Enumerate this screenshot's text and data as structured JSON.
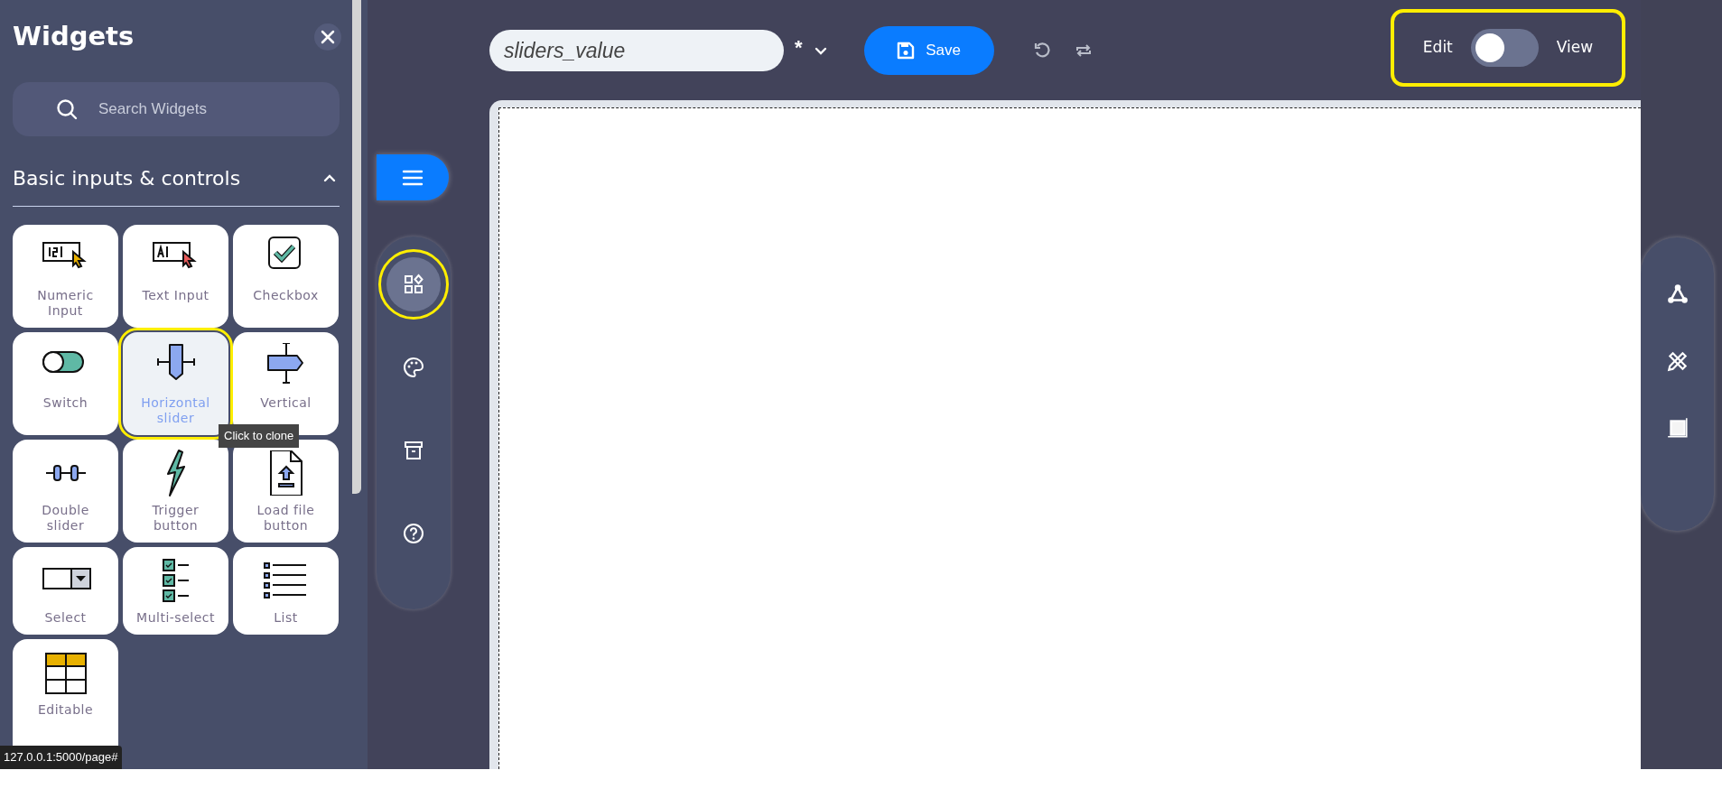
{
  "sidebar": {
    "title": "Widgets",
    "search": {
      "placeholder": "Search Widgets"
    },
    "section": {
      "title": "Basic inputs & controls",
      "expanded": true
    },
    "widgets": [
      {
        "label": "Numeric Input",
        "kind": "numeric",
        "selected": false,
        "highlighted": false
      },
      {
        "label": "Text Input",
        "kind": "text",
        "selected": false,
        "highlighted": false
      },
      {
        "label": "Checkbox",
        "kind": "checkbox",
        "selected": false,
        "highlighted": false
      },
      {
        "label": "Switch",
        "kind": "switch",
        "selected": false,
        "highlighted": false
      },
      {
        "label": "Horizontal slider",
        "kind": "hslider",
        "selected": true,
        "highlighted": true
      },
      {
        "label": "Vertical",
        "kind": "vslider",
        "selected": false,
        "highlighted": false
      },
      {
        "label": "Double slider",
        "kind": "double",
        "selected": false,
        "highlighted": false
      },
      {
        "label": "Trigger button",
        "kind": "trigger",
        "selected": false,
        "highlighted": false
      },
      {
        "label": "Load file button",
        "kind": "load",
        "selected": false,
        "highlighted": false
      },
      {
        "label": "Select",
        "kind": "select",
        "selected": false,
        "highlighted": false
      },
      {
        "label": "Multi-select",
        "kind": "multi",
        "selected": false,
        "highlighted": false
      },
      {
        "label": "List",
        "kind": "list",
        "selected": false,
        "highlighted": false
      },
      {
        "label": "Editable",
        "kind": "table",
        "selected": false,
        "highlighted": false
      }
    ],
    "tooltip": "Click to clone"
  },
  "tools": [
    {
      "kind": "widgets",
      "selected": true,
      "highlighted": true
    },
    {
      "kind": "palette",
      "selected": false,
      "highlighted": false
    },
    {
      "kind": "archive",
      "selected": false,
      "highlighted": false
    },
    {
      "kind": "help",
      "selected": false,
      "highlighted": false
    }
  ],
  "document": {
    "name": "sliders_value",
    "modified_mark": "*",
    "save_label": "Save"
  },
  "mode_switch": {
    "left_label": "Edit",
    "right_label": "View",
    "on": false,
    "highlighted": true
  },
  "right_tools": [
    {
      "kind": "graph"
    },
    {
      "kind": "design"
    },
    {
      "kind": "crop"
    }
  ],
  "status_url": "127.0.0.1:5000/page#"
}
